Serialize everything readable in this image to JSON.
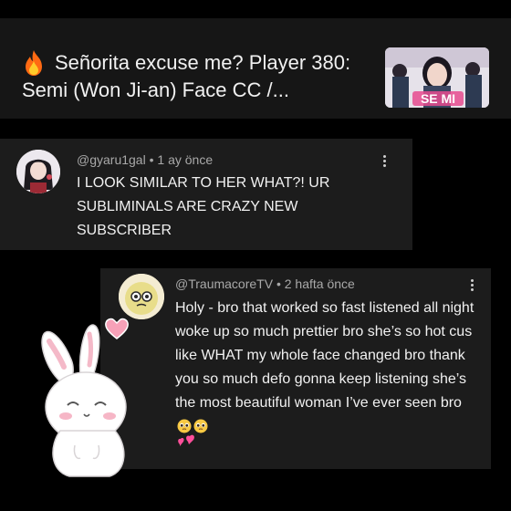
{
  "video": {
    "title": "Señorita excuse me? Player 380: Semi (Won Ji-an) Face CC /...",
    "thumbnail_caption": "SE MI",
    "title_icon": "fire-icon"
  },
  "comments": [
    {
      "author": "@gyaru1gal",
      "time": "1 ay önce",
      "text": "I LOOK SIMILAR TO HER WHAT?! UR SUBLIMINALS ARE CRAZY NEW SUBSCRIBER"
    },
    {
      "author": "@TraumacoreTV",
      "time": "2 hafta önce",
      "text": "Holy - bro that worked so fast listened all night woke up so much prettier bro she’s so hot cus like WHAT my whole face changed bro thank you so much defo gonna keep listening she’s the most beautiful woman I’ve ever seen bro"
    }
  ],
  "meta_separator": "•",
  "colors": {
    "background": "#000000",
    "card": "#1c1c1c",
    "text": "#f1f1f1",
    "meta": "#a9a9a9",
    "heart": "#f7a1b8"
  }
}
